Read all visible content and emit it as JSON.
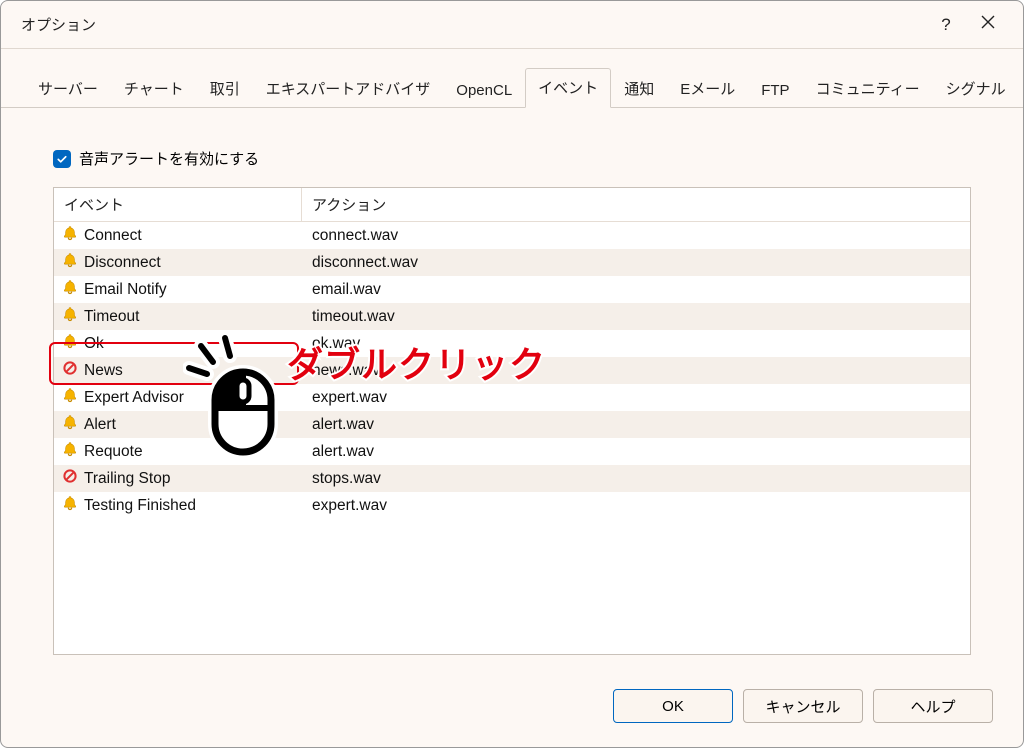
{
  "window": {
    "title": "オプション",
    "help": "?",
    "close": "✕"
  },
  "tabs": [
    "サーバー",
    "チャート",
    "取引",
    "エキスパートアドバイザ",
    "OpenCL",
    "イベント",
    "通知",
    "Eメール",
    "FTP",
    "コミュニティー",
    "シグナル"
  ],
  "active_tab_index": 5,
  "checkbox": {
    "checked": true,
    "label": "音声アラートを有効にする"
  },
  "table": {
    "headers": {
      "event": "イベント",
      "action": "アクション"
    },
    "rows": [
      {
        "icon": "bell",
        "event": "Connect",
        "action": "connect.wav"
      },
      {
        "icon": "bell",
        "event": "Disconnect",
        "action": "disconnect.wav"
      },
      {
        "icon": "bell",
        "event": "Email Notify",
        "action": "email.wav"
      },
      {
        "icon": "bell",
        "event": "Timeout",
        "action": "timeout.wav"
      },
      {
        "icon": "bell",
        "event": "Ok",
        "action": "ok.wav"
      },
      {
        "icon": "forbid",
        "event": "News",
        "action": "news.wav"
      },
      {
        "icon": "bell",
        "event": "Expert Advisor",
        "action": "expert.wav"
      },
      {
        "icon": "bell",
        "event": "Alert",
        "action": "alert.wav"
      },
      {
        "icon": "bell",
        "event": "Requote",
        "action": "alert.wav"
      },
      {
        "icon": "forbid",
        "event": "Trailing Stop",
        "action": "stops.wav"
      },
      {
        "icon": "bell",
        "event": "Testing Finished",
        "action": "expert.wav"
      }
    ]
  },
  "highlight": {
    "row_index": 5,
    "annotation": "ダブルクリック"
  },
  "footer": {
    "ok": "OK",
    "cancel": "キャンセル",
    "help": "ヘルプ"
  },
  "colors": {
    "accent": "#0067c0",
    "annotation": "#e2000f"
  }
}
